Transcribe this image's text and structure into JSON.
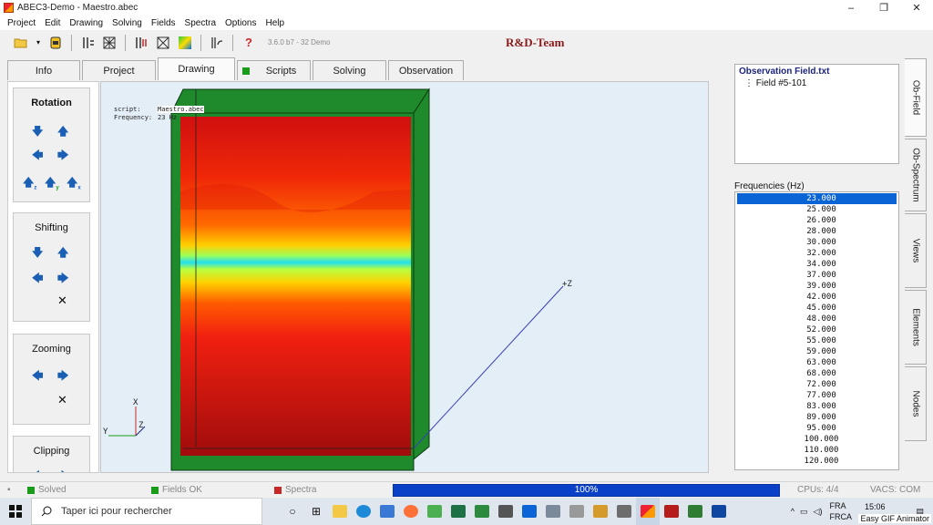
{
  "window": {
    "title": "ABEC3-Demo - Maestro.abec",
    "min": "–",
    "max": "❐",
    "close": "✕"
  },
  "menu": [
    "Project",
    "Edit",
    "Drawing",
    "Solving",
    "Fields",
    "Spectra",
    "Options",
    "Help"
  ],
  "toolbar": {
    "version": "3.6.0 b7 - 32 Demo",
    "brand": "R&D-Team",
    "help_glyph": "?"
  },
  "tabs": [
    "Info",
    "Project",
    "Drawing",
    "Scripts",
    "Solving",
    "Observation"
  ],
  "left_panel": {
    "rotation": "Rotation",
    "shifting": "Shifting",
    "zooming": "Zooming",
    "clipping": "Clipping",
    "rot_z": "z",
    "rot_y": "y",
    "rot_x": "x"
  },
  "viewport": {
    "script_label": "script:",
    "script_value": "Maestro.abec",
    "frequency_label": "Frequency:",
    "frequency_value": "23 Hz",
    "axis_x": "X",
    "axis_y": "Y",
    "axis_z": "Z",
    "axis_plus_z": "+Z"
  },
  "right_panel": {
    "obs_title": "Observation Field.txt",
    "obs_item": "Field #5-101",
    "freq_header": "Frequencies  (Hz)",
    "frequencies": [
      "23.000",
      "25.000",
      "26.000",
      "28.000",
      "30.000",
      "32.000",
      "34.000",
      "37.000",
      "39.000",
      "42.000",
      "45.000",
      "48.000",
      "52.000",
      "55.000",
      "59.000",
      "63.000",
      "68.000",
      "72.000",
      "77.000",
      "83.000",
      "89.000",
      "95.000",
      "100.000",
      "110.000",
      "120.000"
    ],
    "vtabs": [
      "Ob-Field",
      "Ob-Spectrum",
      "Views",
      "Elements",
      "Nodes"
    ]
  },
  "status": {
    "solved": "Solved",
    "fields": "Fields OK",
    "spectra": "Spectra",
    "progress": "100%",
    "progress_value": 1.0,
    "cpus": "CPUs: 4/4",
    "vacs": "VACS: COM"
  },
  "taskbar": {
    "search_placeholder": "Taper ici pour rechercher",
    "lang1": "FRA",
    "lang2": "FRCA",
    "time": "15:06",
    "gif_badge": "Easy GIF Animator"
  },
  "colors": {
    "accent": "#0a64d6",
    "ok": "#1a9c1a",
    "error": "#c62828",
    "progress": "#0a3fc8",
    "brand": "#8b1a1a"
  }
}
